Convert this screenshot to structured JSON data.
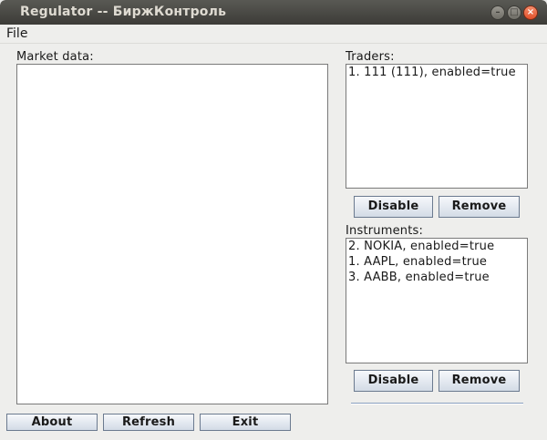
{
  "window": {
    "title": "Regulator -- БиржКонтроль"
  },
  "menu": {
    "file": "File"
  },
  "market": {
    "label": "Market data:"
  },
  "traders": {
    "label": "Traders:",
    "items": [
      "1. 111 (111), enabled=true"
    ],
    "disable_label": "Disable",
    "remove_label": "Remove"
  },
  "instruments": {
    "label": "Instruments:",
    "items": [
      "2. NOKIA, enabled=true",
      "1. AAPL, enabled=true",
      "3. AABB, enabled=true"
    ],
    "disable_label": "Disable",
    "remove_label": "Remove"
  },
  "footer": {
    "about_label": "About",
    "refresh_label": "Refresh",
    "exit_label": "Exit"
  }
}
